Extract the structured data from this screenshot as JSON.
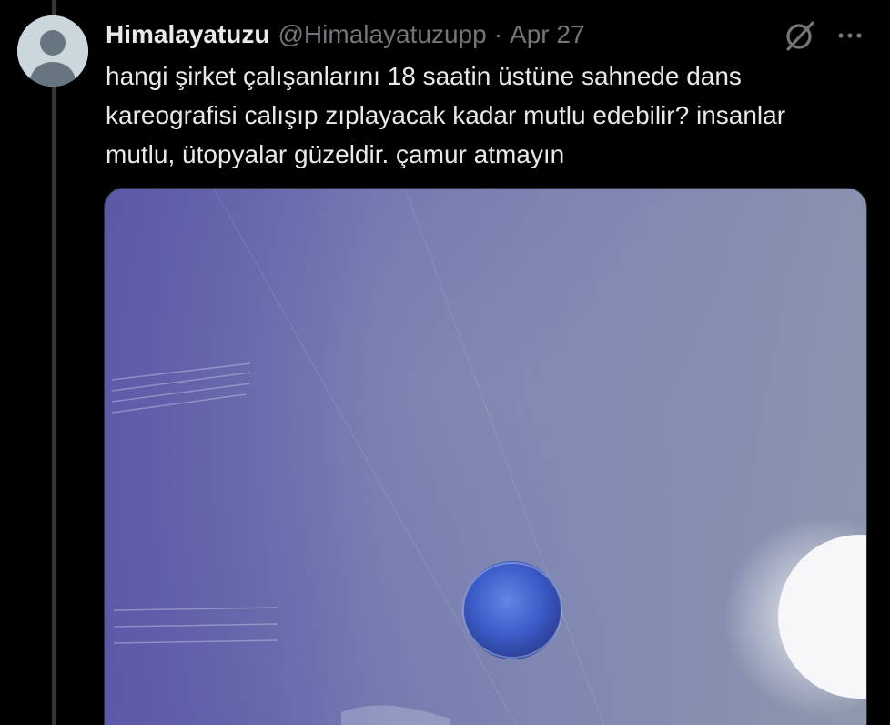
{
  "tweet": {
    "author": {
      "display_name": "Himalayatuzu",
      "handle": "@Himalayatuzupp"
    },
    "separator": "·",
    "timestamp": "Apr 27",
    "text": "hangi şirket çalışanlarını 18 saatin üstüne sahnede dans\nkareografisi calışıp zıplayacak kadar mutlu edebilir? insanlar\nmutlu, ütopyalar güzeldir. çamur atmayın",
    "icons": {
      "grok": "grok-icon",
      "more": "more-options-icon",
      "avatar": "default-avatar-icon"
    },
    "media": {
      "type": "video-still"
    }
  },
  "colors": {
    "background": "#000000",
    "primary_text": "#e7e9ea",
    "secondary_text": "#71767b",
    "thread_line": "#333639"
  }
}
